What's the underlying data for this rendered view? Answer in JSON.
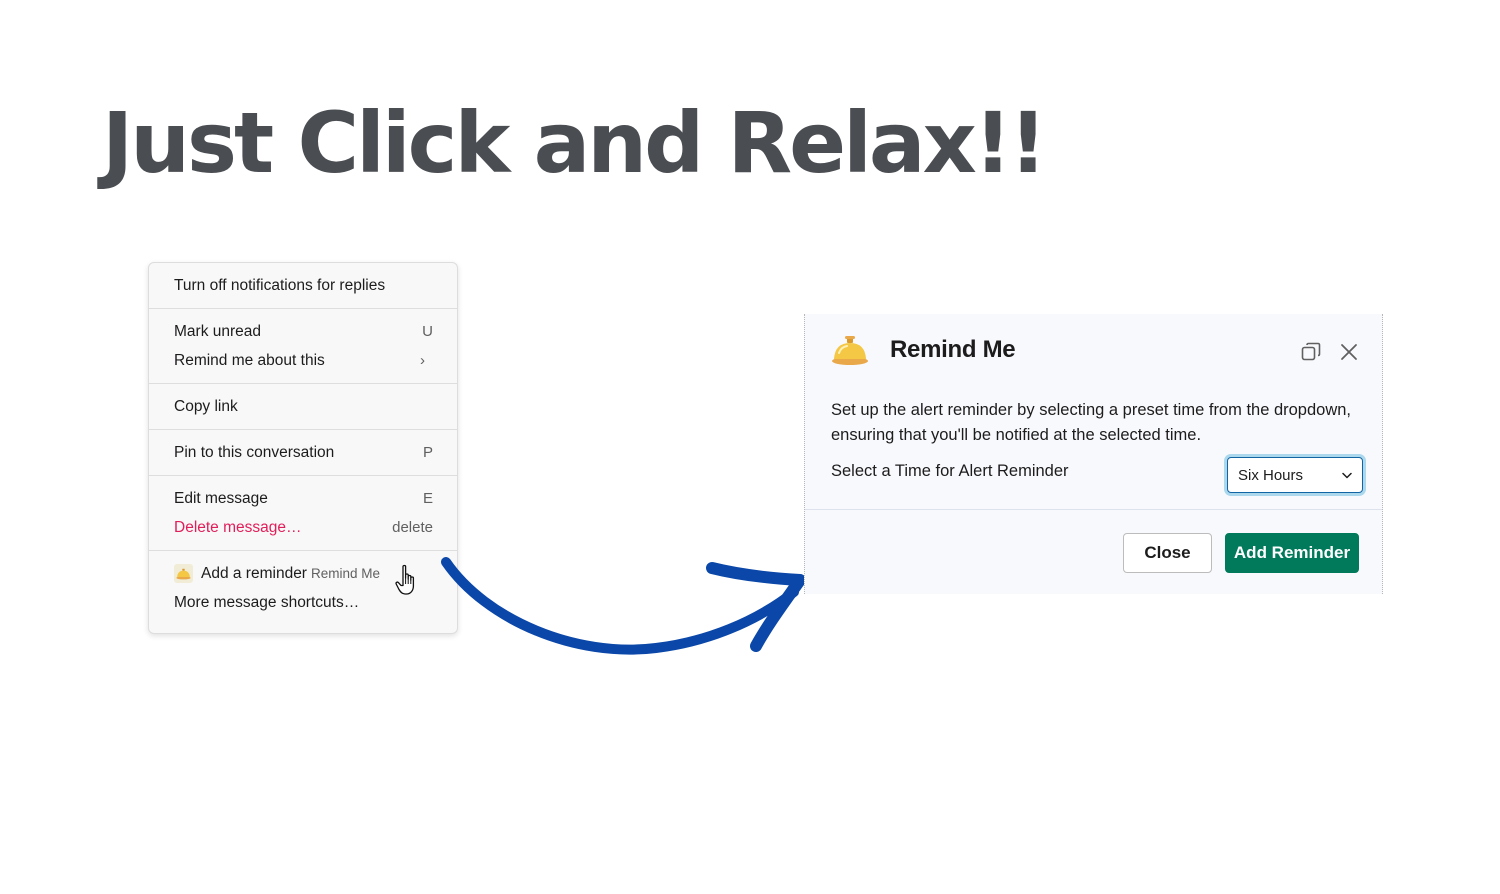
{
  "headline": "Just Click and Relax!!",
  "context_menu": {
    "groups": [
      {
        "items": [
          {
            "label": "Turn off notifications for replies"
          }
        ]
      },
      {
        "items": [
          {
            "label": "Mark unread",
            "shortcut": "U"
          },
          {
            "label": "Remind me about this",
            "shortcut": "›"
          }
        ]
      },
      {
        "items": [
          {
            "label": "Copy link"
          }
        ]
      },
      {
        "items": [
          {
            "label": "Pin to this conversation",
            "shortcut": "P"
          }
        ]
      },
      {
        "items": [
          {
            "label": "Edit message",
            "shortcut": "E"
          },
          {
            "label": "Delete message…",
            "shortcut": "delete"
          }
        ]
      },
      {
        "items": [
          {
            "label": "Add a reminder",
            "hint": "Remind Me",
            "icon": "bellhop-bell-icon"
          },
          {
            "label": "More message shortcuts…"
          }
        ]
      }
    ],
    "danger_color": "#e01e5a"
  },
  "modal": {
    "title": "Remind Me",
    "icon": "bellhop-bell-icon",
    "description": "Set up the alert reminder by selecting a preset time from the dropdown, ensuring that you'll be notified at the selected time.",
    "field_label": "Select a Time for Alert Reminder",
    "select_value": "Six Hours",
    "close_label": "Close",
    "submit_label": "Add Reminder",
    "accent_color": "#007a5a"
  },
  "arrow_color": "#0a47a8"
}
